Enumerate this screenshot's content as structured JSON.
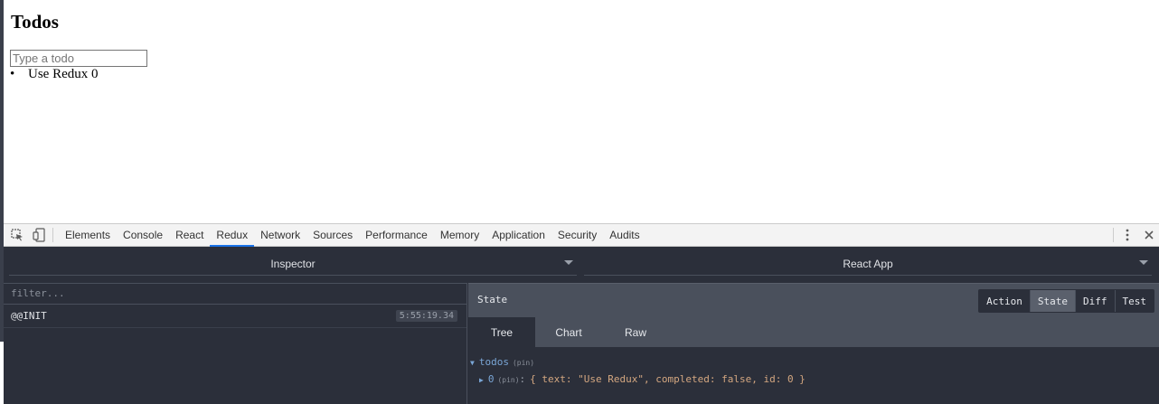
{
  "app": {
    "title": "Todos",
    "input_placeholder": "Type a todo",
    "todos": [
      {
        "bullet": "•",
        "text": "Use Redux 0"
      }
    ]
  },
  "devtools": {
    "tabs": [
      {
        "label": "Elements"
      },
      {
        "label": "Console"
      },
      {
        "label": "React"
      },
      {
        "label": "Redux"
      },
      {
        "label": "Network"
      },
      {
        "label": "Sources"
      },
      {
        "label": "Performance"
      },
      {
        "label": "Memory"
      },
      {
        "label": "Application"
      },
      {
        "label": "Security"
      },
      {
        "label": "Audits"
      }
    ],
    "active_tab": "Redux",
    "accent_color": "#1a73e8"
  },
  "redux": {
    "monitor_select": "Inspector",
    "instance_select": "React App",
    "filter_placeholder": "filter...",
    "actions": [
      {
        "name": "@@INIT",
        "time": "5:55:19.34"
      }
    ],
    "state_title": "State",
    "modes": [
      {
        "label": "Action"
      },
      {
        "label": "State"
      },
      {
        "label": "Diff"
      },
      {
        "label": "Test"
      }
    ],
    "active_mode": "State",
    "view_tabs": [
      {
        "label": "Tree"
      },
      {
        "label": "Chart"
      },
      {
        "label": "Raw"
      }
    ],
    "active_view": "Tree",
    "tree": {
      "root_key": "todos",
      "pin": "(pin)",
      "child_key": "0",
      "child_value": "{ text: \"Use Redux\", completed: false, id: 0 }"
    }
  }
}
